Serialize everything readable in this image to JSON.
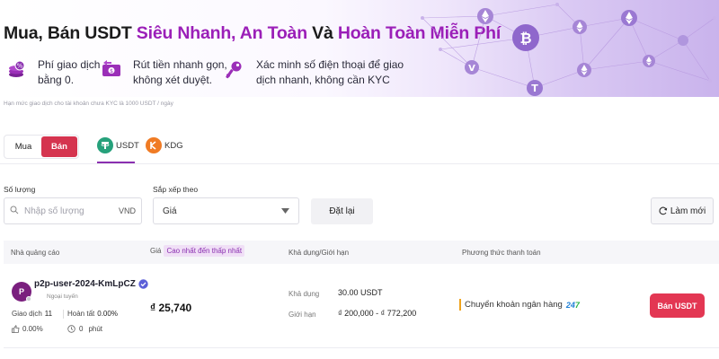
{
  "banner": {
    "title_prefix": "Mua, Bán USDT ",
    "title_hl1": "Siêu Nhanh, An Toàn",
    "title_mid": " Và ",
    "title_hl2": "Hoàn Toàn Miễn Phí",
    "features": [
      {
        "line1": "Phí giao dịch",
        "line2": "bằng 0.",
        "icon": "coins-icon"
      },
      {
        "line1": "Rút tiền nhanh gọn,",
        "line2": "không xét duyệt.",
        "icon": "cash-withdraw-icon"
      },
      {
        "line1": "Xác minh số điện thoại để giao",
        "line2": "dịch nhanh, không cần KYC",
        "icon": "key-icon"
      }
    ]
  },
  "disclaimer": "Hạn mức giao dịch cho tài khoản chưa KYC là 1000 USDT / ngày",
  "toggle": {
    "buy": "Mua",
    "sell": "Bán"
  },
  "coins": [
    {
      "label": "USDT",
      "icon": "tether-icon"
    },
    {
      "label": "KDG",
      "icon": "kdg-icon"
    }
  ],
  "filters": {
    "amount_label": "Số lượng",
    "amount_placeholder": "Nhập số lượng",
    "amount_unit": "VND",
    "sort_label": "Sắp xếp theo",
    "sort_value": "Giá",
    "reset_label": "Đặt lại",
    "refresh_label": "Làm mới"
  },
  "table": {
    "headers": {
      "advertiser": "Nhà quảng cáo",
      "price": "Giá",
      "price_sort": "Cao nhất đến thấp nhất",
      "available": "Khả dụng/Giới hạn",
      "payment": "Phương thức thanh toán"
    },
    "rows": [
      {
        "avatar_letter": "P",
        "username": "p2p-user-2024-KmLpCZ",
        "status": "Ngoại tuyến",
        "trades_label": "Giao dịch",
        "trades": "11",
        "completion_label": "Hoàn tất",
        "completion": "0.00%",
        "like_rate": "0.00%",
        "time_value": "0",
        "time_unit": "phút",
        "price": "₫ 25,740",
        "available_label": "Khả dụng",
        "available": "30.00 USDT",
        "limit_label": "Giới hạn",
        "limit": "₫ 200,000 - ₫ 772,200",
        "payment_method": "Chuyển khoản ngân hàng",
        "payment_badge": "247",
        "action": "Bán USDT"
      }
    ]
  },
  "colors": {
    "accent": "#9b1fb8",
    "sell": "#d5344f",
    "sell_button": "#e33753",
    "tether": "#26a17b",
    "kdg": "#f07b24"
  }
}
